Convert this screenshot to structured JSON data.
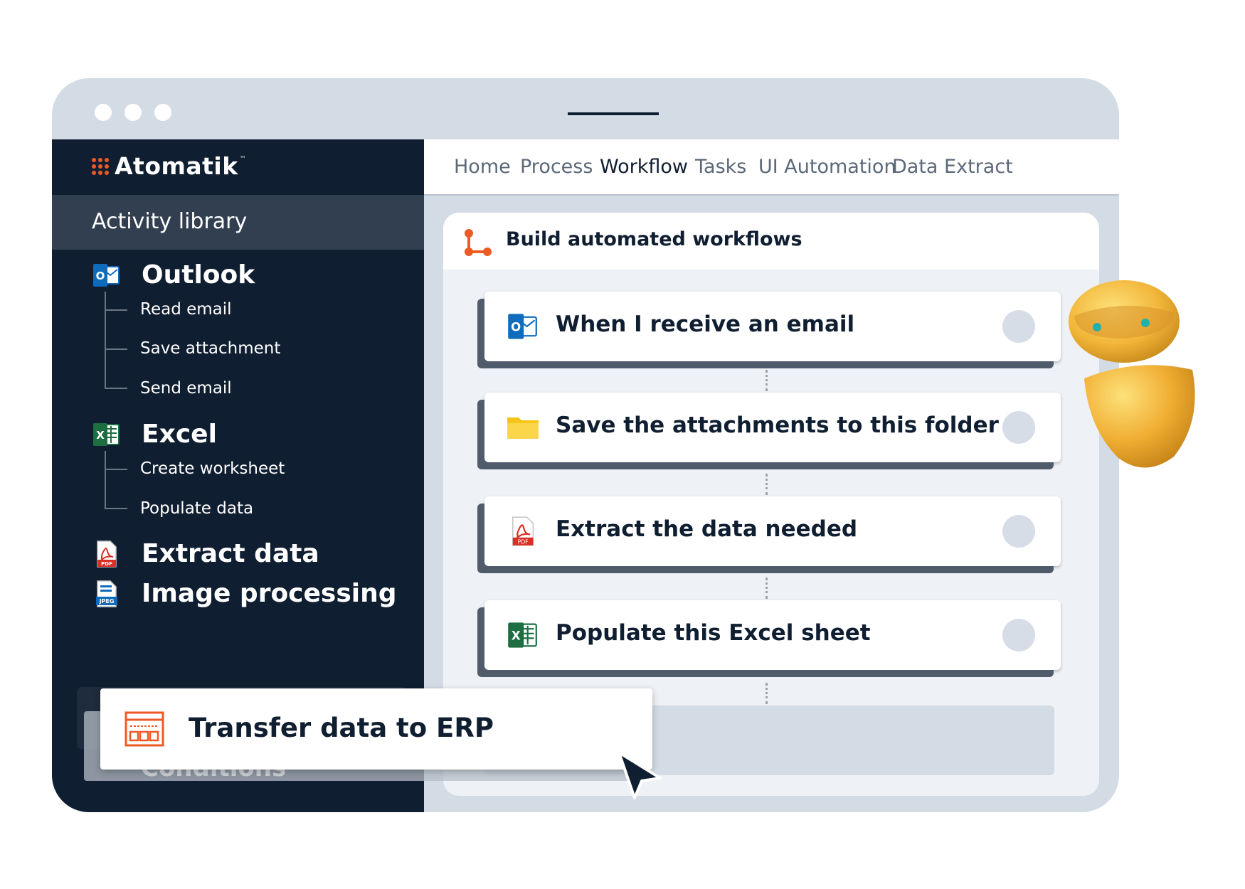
{
  "brand": {
    "name": "Atomatik",
    "tm": "™"
  },
  "sidebar": {
    "header": "Activity library",
    "categories": [
      {
        "label": "Outlook",
        "icon": "outlook-icon",
        "items": [
          "Read email",
          "Save attachment",
          "Send email"
        ]
      },
      {
        "label": "Excel",
        "icon": "excel-icon",
        "items": [
          "Create worksheet",
          "Populate data"
        ]
      },
      {
        "label": "Extract data",
        "icon": "pdf-icon",
        "items": []
      },
      {
        "label": "Image processing",
        "icon": "jpeg-icon",
        "items": []
      }
    ],
    "hidden_item": "Conditions"
  },
  "nav": {
    "tabs": [
      "Home",
      "Process",
      "Workflow",
      "Tasks",
      "UI Automation",
      "Data Extract"
    ],
    "active": "Workflow"
  },
  "panel": {
    "title": "Build automated workflows",
    "steps": [
      {
        "label": "When I receive an email",
        "icon": "outlook-icon"
      },
      {
        "label": "Save the attachments to this folder",
        "icon": "folder-icon"
      },
      {
        "label": "Extract the data needed",
        "icon": "pdf-icon"
      },
      {
        "label": "Populate this Excel sheet",
        "icon": "excel-icon"
      }
    ]
  },
  "dragging": {
    "label": "Transfer data to ERP",
    "icon": "erp-icon"
  },
  "colors": {
    "sidebar": "#101e31",
    "accent": "#ee5a24",
    "frame": "#d3dbe5"
  }
}
